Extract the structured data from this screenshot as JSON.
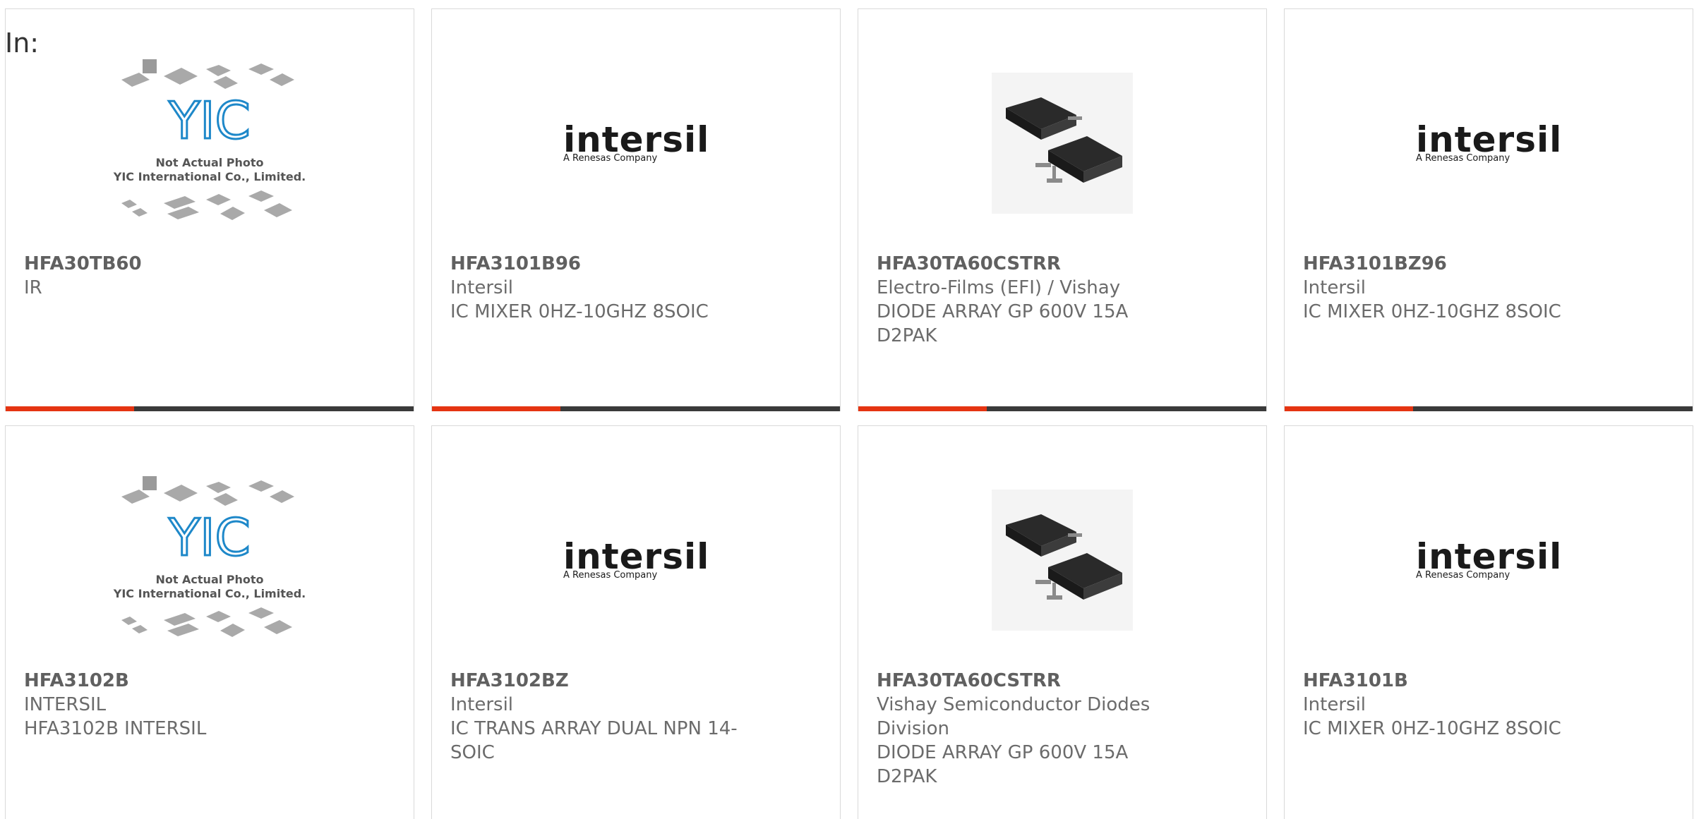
{
  "filter": {
    "label": "In:"
  },
  "colors": {
    "accent": "#e53412",
    "bar": "#3a3a3a",
    "border": "#d9d9d9"
  },
  "cards": [
    {
      "image": "yic-placeholder-icon",
      "image_caption_1": "Not Actual Photo",
      "image_caption_2": "YIC International Co., Limited.",
      "logo_text": "YIC",
      "part": "HFA30TB60",
      "maker": "IR",
      "desc": ""
    },
    {
      "image": "intersil-logo-icon",
      "logo_word": "intersil",
      "logo_sub": "A Renesas Company",
      "part": "HFA3101B96",
      "maker": "Intersil",
      "desc": "IC MIXER 0HZ-10GHZ 8SOIC"
    },
    {
      "image": "d2pak-package-icon",
      "part": "HFA30TA60CSTRR",
      "maker": "Electro-Films (EFI) / Vishay",
      "desc": "DIODE ARRAY GP 600V 15A D2PAK"
    },
    {
      "image": "intersil-logo-icon",
      "logo_word": "intersil",
      "logo_sub": "A Renesas Company",
      "part": "HFA3101BZ96",
      "maker": "Intersil",
      "desc": "IC MIXER 0HZ-10GHZ 8SOIC"
    },
    {
      "image": "yic-placeholder-icon",
      "image_caption_1": "Not Actual Photo",
      "image_caption_2": "YIC International Co., Limited.",
      "logo_text": "YIC",
      "part": "HFA3102B",
      "maker": "INTERSIL",
      "desc": "HFA3102B INTERSIL"
    },
    {
      "image": "intersil-logo-icon",
      "logo_word": "intersil",
      "logo_sub": "A Renesas Company",
      "part": "HFA3102BZ",
      "maker": "Intersil",
      "desc": "IC TRANS ARRAY DUAL NPN 14-SOIC"
    },
    {
      "image": "d2pak-package-icon",
      "part": "HFA30TA60CSTRR",
      "maker": "Vishay Semiconductor Diodes Division",
      "desc": "DIODE ARRAY GP 600V 15A D2PAK"
    },
    {
      "image": "intersil-logo-icon",
      "logo_word": "intersil",
      "logo_sub": "A Renesas Company",
      "part": "HFA3101B",
      "maker": "Intersil",
      "desc": "IC MIXER 0HZ-10GHZ 8SOIC"
    }
  ]
}
